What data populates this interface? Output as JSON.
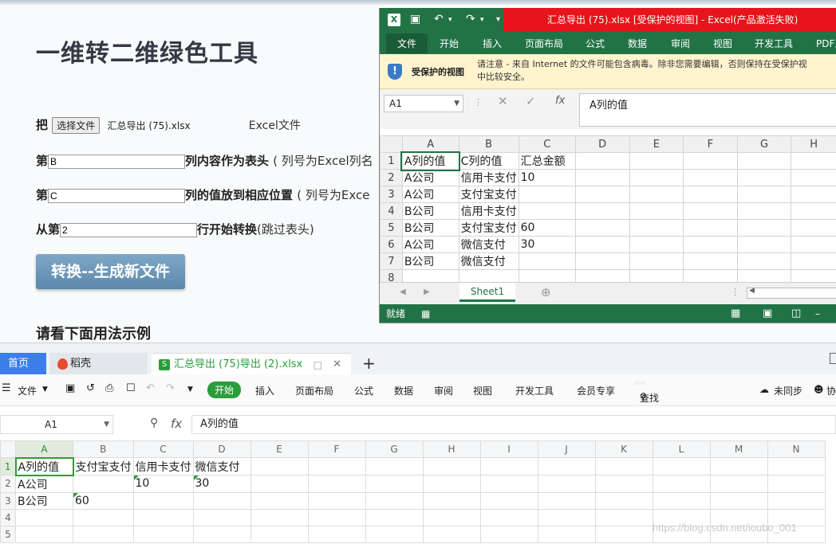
{
  "web": {
    "title": "一维转二维绿色工具",
    "row1_prefix": "把",
    "row1_button": "选择文件",
    "row1_filename": "汇总导出 (75).xlsx",
    "row1_suffix": "Excel文件",
    "row2_prefix": "第",
    "row2_value": "B",
    "row2_bold": "列内容作为表头",
    "row2_light": "( 列号为Excel列名",
    "row3_prefix": "第",
    "row3_value": "C",
    "row3_bold": "列的值放到相应位置",
    "row3_light": "( 列号为Exce",
    "row4_prefix": "从第",
    "row4_value": "2",
    "row4_bold": "行开始转换",
    "row4_light": "(跳过表头)",
    "convert_button": "转换--生成新文件",
    "example_heading": "请看下面用法示例"
  },
  "excel": {
    "title": "汇总导出 (75).xlsx  [受保护的视图]  -  Excel(产品激活失败)",
    "menu": [
      "文件",
      "开始",
      "插入",
      "页面布局",
      "公式",
      "数据",
      "审阅",
      "视图",
      "开发工具",
      "PDF工"
    ],
    "warning_title": "受保护的视图",
    "warning_text_1": "请注意 - 来自 Internet 的文件可能包含病毒。除非您需要编辑，否则保持在受保护视",
    "warning_text_2": "中比较安全。",
    "namebox": "A1",
    "formula": "A列的值",
    "fx_symbol": "fx",
    "col_headers": [
      "A",
      "B",
      "C",
      "D",
      "E",
      "F",
      "G",
      "H"
    ],
    "rows": [
      {
        "num": "1",
        "cells": [
          "A列的值",
          "C列的值",
          "汇总金额"
        ]
      },
      {
        "num": "2",
        "cells": [
          "A公司",
          "信用卡支付",
          "10"
        ]
      },
      {
        "num": "3",
        "cells": [
          "A公司",
          "支付宝支付",
          ""
        ]
      },
      {
        "num": "4",
        "cells": [
          "B公司",
          "信用卡支付",
          ""
        ]
      },
      {
        "num": "5",
        "cells": [
          "B公司",
          "支付宝支付",
          "60"
        ]
      },
      {
        "num": "6",
        "cells": [
          "A公司",
          "微信支付",
          "30"
        ]
      },
      {
        "num": "7",
        "cells": [
          "B公司",
          "微信支付",
          ""
        ]
      },
      {
        "num": "8",
        "cells": [
          "",
          "",
          ""
        ]
      }
    ],
    "sheet_tab": "Sheet1",
    "status": "就绪"
  },
  "wps": {
    "tab_home": "首页",
    "tab_daoke": "稻壳",
    "tab_file": "汇总导出 (75)导出 (2).xlsx",
    "toolbar": {
      "file": "文件",
      "start": "开始",
      "insert": "插入",
      "layout": "页面布局",
      "formula": "公式",
      "data": "数据",
      "review": "审阅",
      "view": "视图",
      "dev": "开发工具",
      "vip": "会员专享",
      "search": "查找",
      "sync": "未同步",
      "collab": "协"
    },
    "namebox": "A1",
    "formula": "A列的值",
    "fx_symbol": "fx",
    "col_headers": [
      "A",
      "B",
      "C",
      "D",
      "E",
      "F",
      "G",
      "H",
      "I",
      "J",
      "K",
      "L",
      "M",
      "N"
    ],
    "rows": [
      {
        "num": "1",
        "cells": [
          "A列的值",
          "支付宝支付",
          "信用卡支付",
          "微信支付"
        ]
      },
      {
        "num": "2",
        "cells": [
          "A公司",
          "",
          "10",
          "30"
        ]
      },
      {
        "num": "3",
        "cells": [
          "B公司",
          "60",
          "",
          ""
        ]
      },
      {
        "num": "4",
        "cells": [
          "",
          "",
          "",
          ""
        ]
      },
      {
        "num": "5",
        "cells": [
          "",
          "",
          "",
          ""
        ]
      }
    ]
  },
  "watermark": "https://blog.csdn.net/ioubo_001"
}
